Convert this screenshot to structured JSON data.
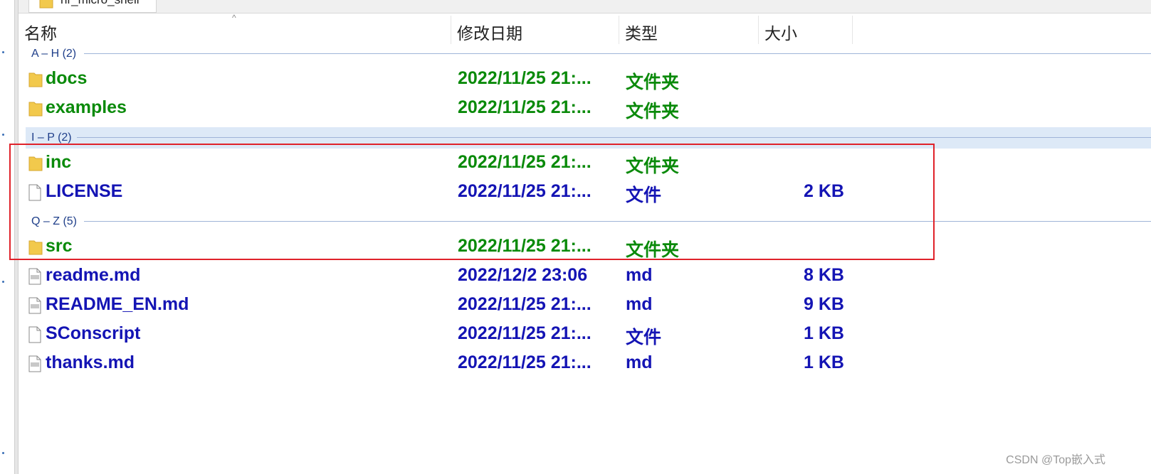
{
  "tab": {
    "label": "nr_micro_shell"
  },
  "columns": {
    "name": "名称",
    "modified": "修改日期",
    "type": "类型",
    "size": "大小"
  },
  "groups": [
    {
      "label": "A – H (2)"
    },
    {
      "label": "I – P (2)"
    },
    {
      "label": "Q – Z (5)"
    }
  ],
  "rows": [
    {
      "name": "docs",
      "date": "2022/11/25 21:...",
      "type": "文件夹",
      "size": "",
      "icon": "folder-icon"
    },
    {
      "name": "examples",
      "date": "2022/11/25 21:...",
      "type": "文件夹",
      "size": "",
      "icon": "folder-icon"
    },
    {
      "name": "inc",
      "date": "2022/11/25 21:...",
      "type": "文件夹",
      "size": "",
      "icon": "folder-icon"
    },
    {
      "name": "LICENSE",
      "date": "2022/11/25 21:...",
      "type": "文件",
      "size": "2 KB",
      "icon": "file-icon"
    },
    {
      "name": "src",
      "date": "2022/11/25 21:...",
      "type": "文件夹",
      "size": "",
      "icon": "folder-icon"
    },
    {
      "name": "readme.md",
      "date": "2022/12/2 23:06",
      "type": "md",
      "size": "8 KB",
      "icon": "markdown-file-icon"
    },
    {
      "name": "README_EN.md",
      "date": "2022/11/25 21:...",
      "type": "md",
      "size": "9 KB",
      "icon": "markdown-file-icon"
    },
    {
      "name": "SConscript",
      "date": "2022/11/25 21:...",
      "type": "文件",
      "size": "1 KB",
      "icon": "file-icon"
    },
    {
      "name": "thanks.md",
      "date": "2022/11/25 21:...",
      "type": "md",
      "size": "1 KB",
      "icon": "markdown-file-icon"
    }
  ],
  "colors": {
    "folder_text": "#0a8a0a",
    "file_text": "#1414b4",
    "highlight_border": "#e0222a",
    "group_selected_bg": "#dde9f7"
  },
  "watermark": "CSDN @Top嵌入式"
}
